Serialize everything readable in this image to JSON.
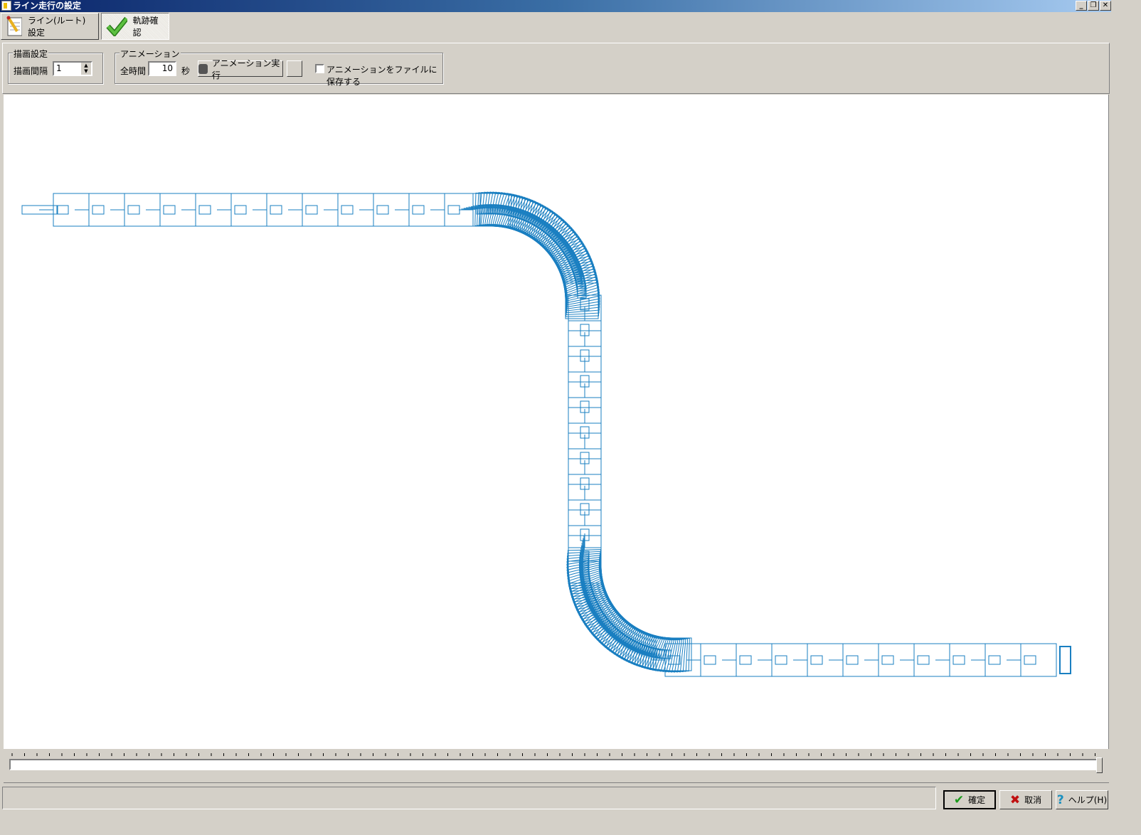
{
  "window": {
    "title": "ライン走行の設定",
    "minimize": "_",
    "restore": "❐",
    "close": "✕"
  },
  "tabs": [
    {
      "label": "ライン(ルート)設定",
      "icon": "notepad-pencil-icon"
    },
    {
      "label": "軌跡確認",
      "icon": "green-check-icon",
      "active": true
    }
  ],
  "draw_settings": {
    "group_label": "描画設定",
    "interval_label": "描画間隔",
    "interval_value": "1"
  },
  "animation": {
    "group_label": "アニメーション",
    "total_time_label": "全時間",
    "total_time_value": "10",
    "unit": "秒",
    "run_button": "アニメーション実行",
    "save_checkbox_label": "アニメーションをファイルに保存する",
    "save_checked": false
  },
  "slider": {
    "position": 1.0
  },
  "footer": {
    "ok": "確定",
    "cancel": "取消",
    "help": "ヘルプ(H)"
  },
  "colors": {
    "trajectory": "#1a7fc1",
    "title_start": "#0a246a"
  }
}
